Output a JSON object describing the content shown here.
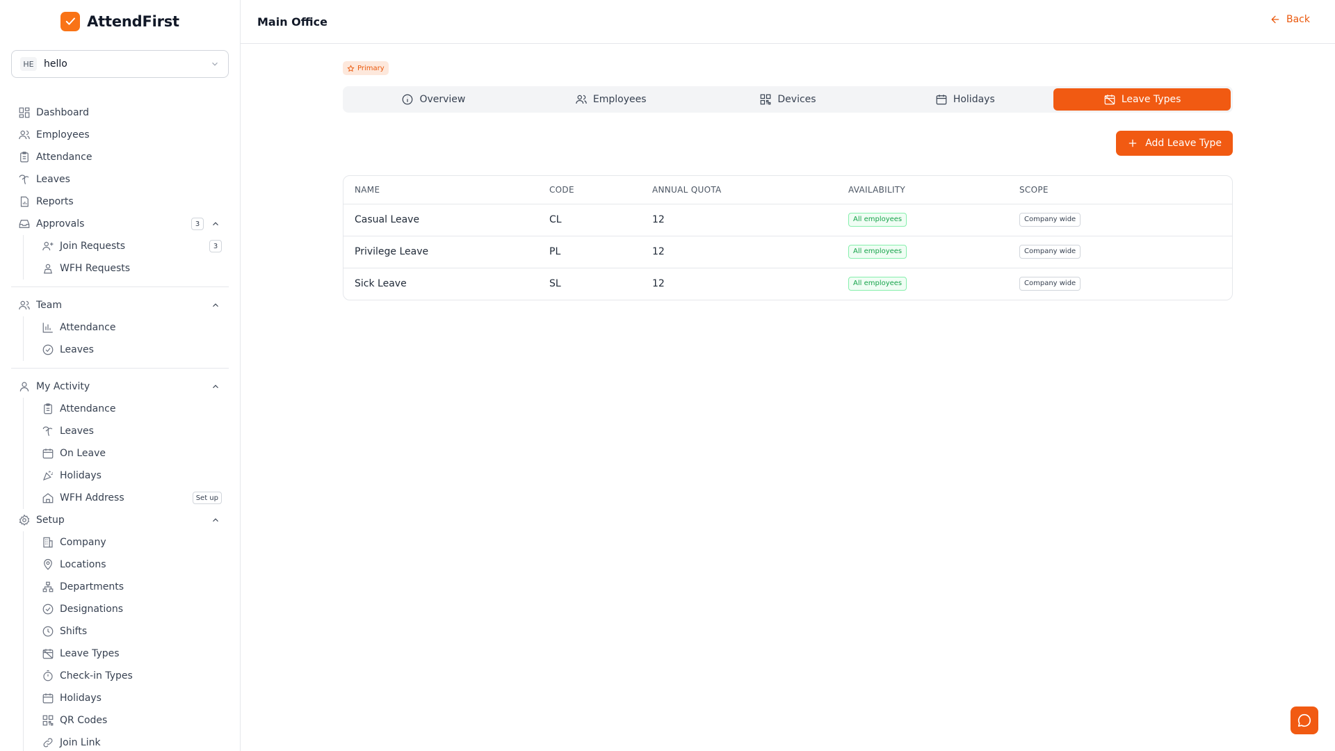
{
  "brand": {
    "name": "AttendFirst",
    "accent": "#f15a12"
  },
  "org": {
    "initials": "HE",
    "name": "hello"
  },
  "sidebar": {
    "dashboard": "Dashboard",
    "employees": "Employees",
    "attendance": "Attendance",
    "leaves": "Leaves",
    "reports": "Reports",
    "approvals": {
      "label": "Approvals",
      "badge": "3",
      "join_requests": "Join Requests",
      "join_badge": "3",
      "wfh_requests": "WFH Requests"
    },
    "team": {
      "label": "Team",
      "attendance": "Attendance",
      "leaves": "Leaves"
    },
    "my_activity": {
      "label": "My Activity",
      "attendance": "Attendance",
      "leaves": "Leaves",
      "on_leave": "On Leave",
      "holidays": "Holidays",
      "wfh_address": "WFH Address",
      "wfh_badge": "Set up"
    },
    "setup": {
      "label": "Setup",
      "company": "Company",
      "locations": "Locations",
      "departments": "Departments",
      "designations": "Designations",
      "shifts": "Shifts",
      "leave_types": "Leave Types",
      "checkin_types": "Check-in Types",
      "holidays": "Holidays",
      "qr_codes": "QR Codes",
      "join_link": "Join Link"
    }
  },
  "header": {
    "title": "Main Office",
    "back": "Back"
  },
  "main": {
    "badge": "Primary",
    "tabs": {
      "overview": "Overview",
      "employees": "Employees",
      "devices": "Devices",
      "holidays": "Holidays",
      "leave_types": "Leave Types"
    },
    "add_button": "Add Leave Type",
    "table": {
      "headers": {
        "name": "NAME",
        "code": "CODE",
        "quota": "ANNUAL QUOTA",
        "availability": "AVAILABILITY",
        "scope": "SCOPE"
      },
      "rows": [
        {
          "name": "Casual Leave",
          "code": "CL",
          "quota": "12",
          "availability": "All employees",
          "scope": "Company wide"
        },
        {
          "name": "Privilege Leave",
          "code": "PL",
          "quota": "12",
          "availability": "All employees",
          "scope": "Company wide"
        },
        {
          "name": "Sick Leave",
          "code": "SL",
          "quota": "12",
          "availability": "All employees",
          "scope": "Company wide"
        }
      ]
    }
  }
}
